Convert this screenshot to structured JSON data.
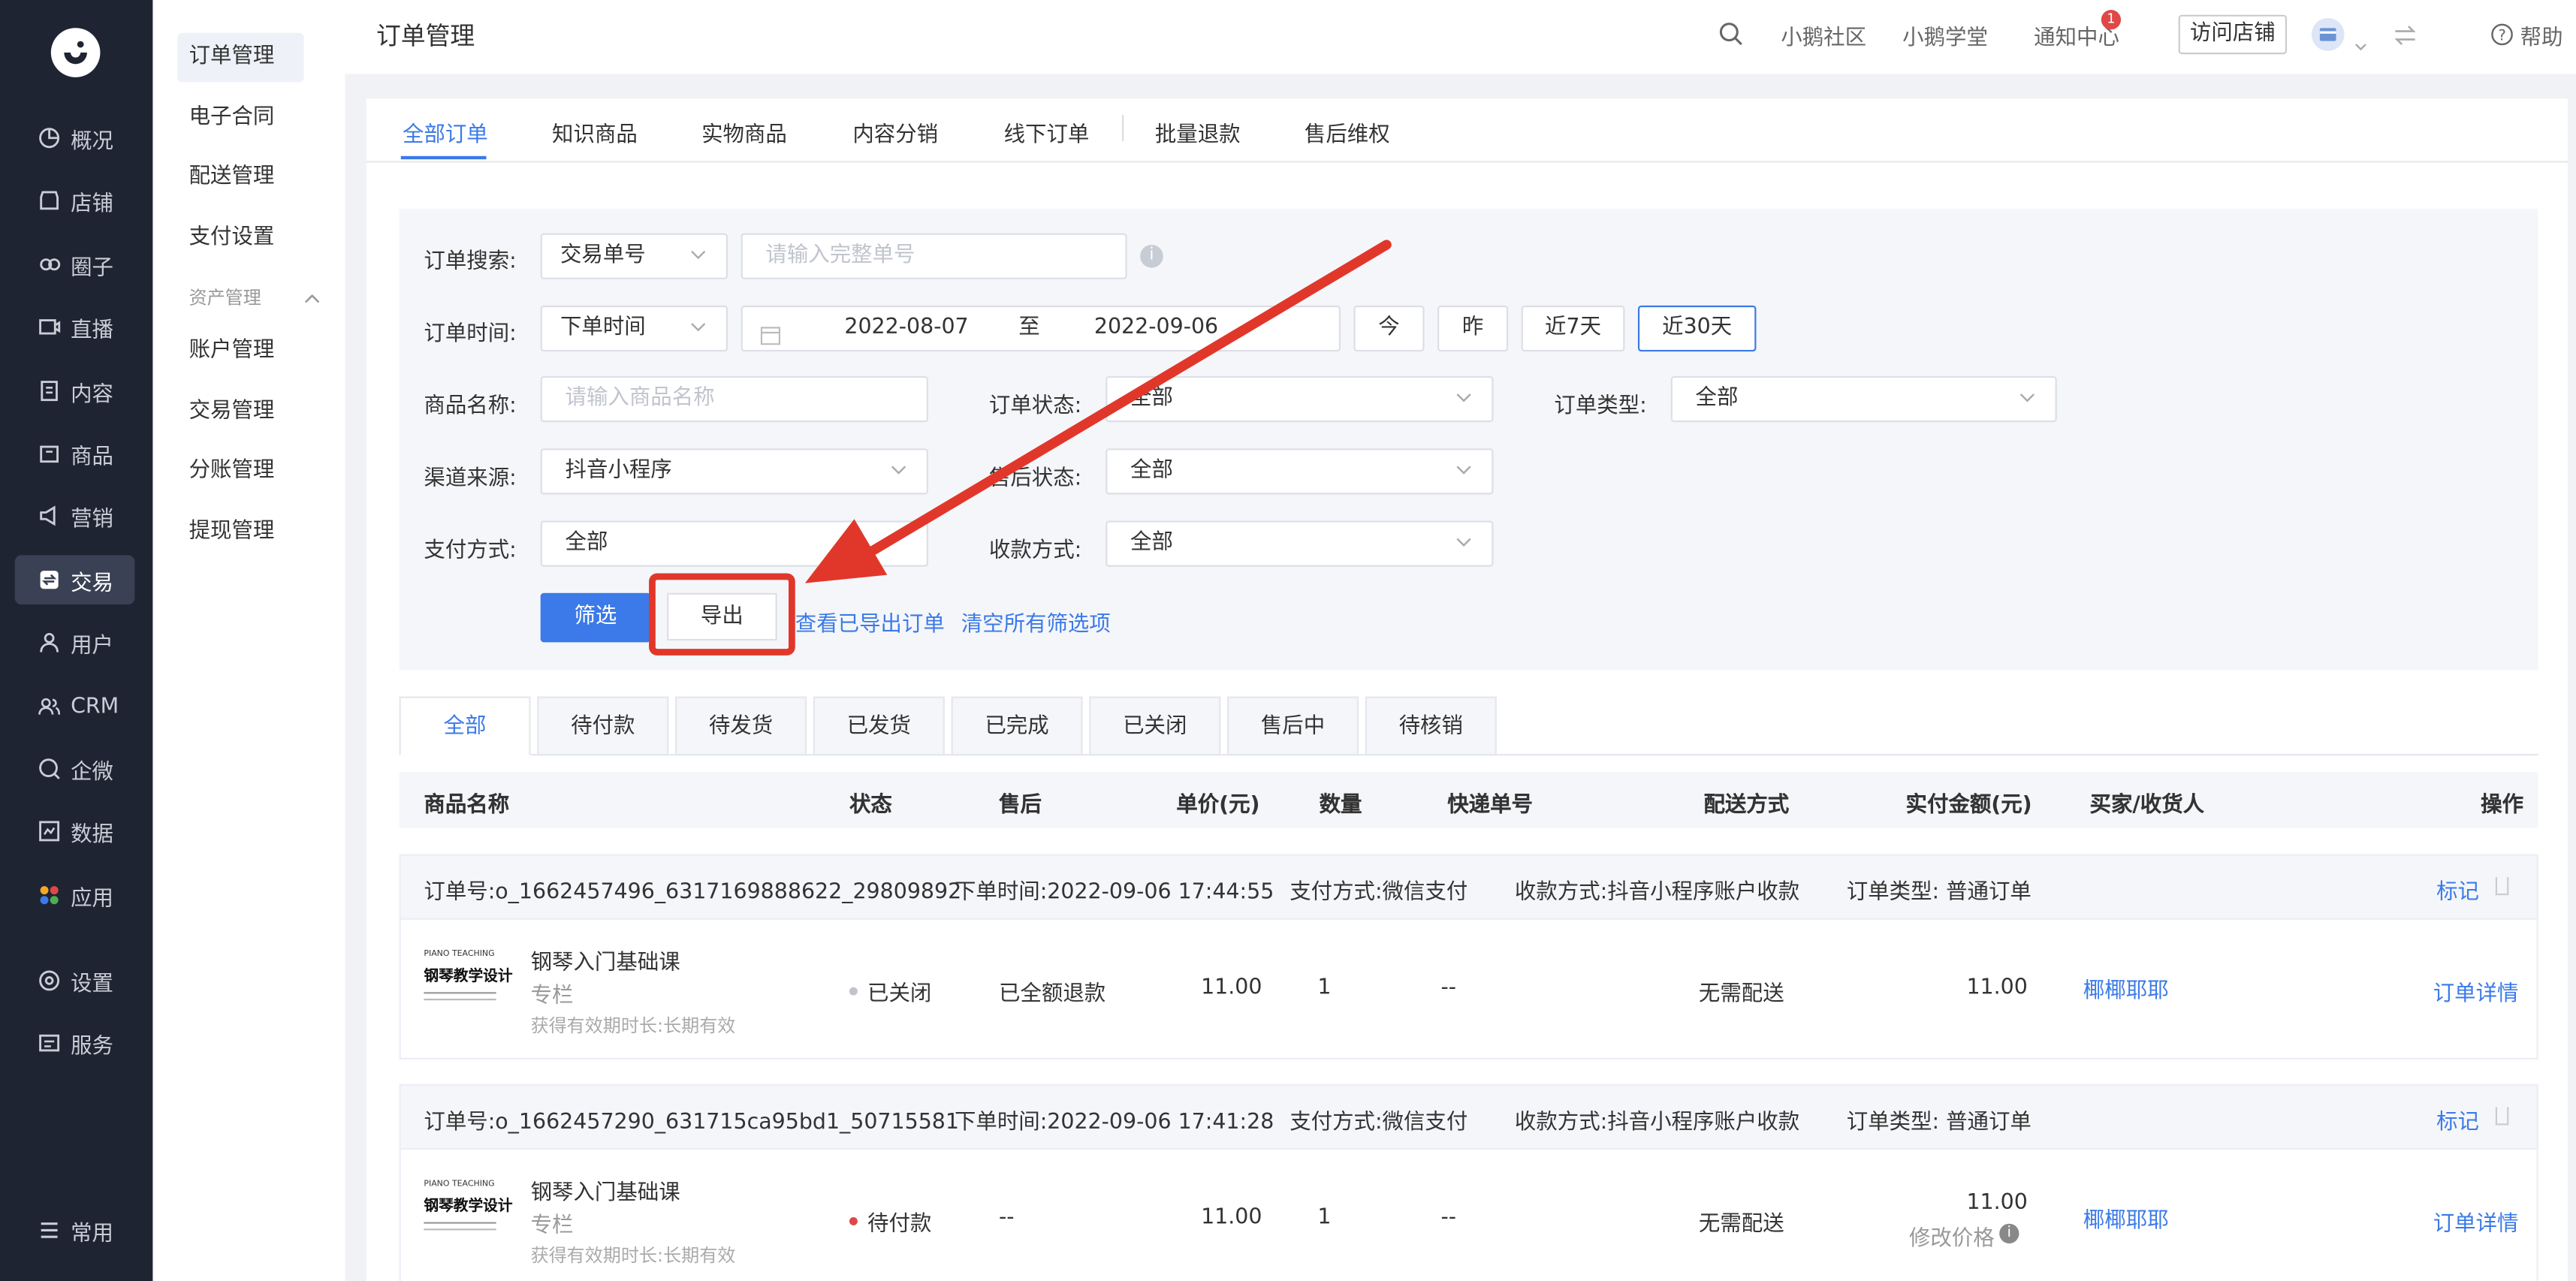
{
  "nav": {
    "items": [
      {
        "label": "概况",
        "icon": "overview-icon"
      },
      {
        "label": "店铺",
        "icon": "store-icon"
      },
      {
        "label": "圈子",
        "icon": "circle-icon"
      },
      {
        "label": "直播",
        "icon": "live-icon"
      },
      {
        "label": "内容",
        "icon": "content-icon"
      },
      {
        "label": "商品",
        "icon": "goods-icon"
      },
      {
        "label": "营销",
        "icon": "marketing-icon"
      },
      {
        "label": "交易",
        "icon": "trade-icon"
      },
      {
        "label": "用户",
        "icon": "user-icon"
      },
      {
        "label": "CRM",
        "icon": "crm-icon"
      },
      {
        "label": "企微",
        "icon": "wecom-icon"
      },
      {
        "label": "数据",
        "icon": "data-icon"
      },
      {
        "label": "应用",
        "icon": "apps-icon"
      },
      {
        "label": "设置",
        "icon": "settings-icon"
      },
      {
        "label": "服务",
        "icon": "service-icon"
      }
    ],
    "common": "常用"
  },
  "subnav": {
    "items": [
      "订单管理",
      "电子合同",
      "配送管理",
      "支付设置"
    ],
    "group": "资产管理",
    "group_items": [
      "账户管理",
      "交易管理",
      "分账管理",
      "提现管理"
    ]
  },
  "topbar": {
    "title": "订单管理",
    "links": [
      "小鹅社区",
      "小鹅学堂",
      "通知中心"
    ],
    "badge": "1",
    "visit": "访问店铺",
    "help": "帮助"
  },
  "tabs": [
    "全部订单",
    "知识商品",
    "实物商品",
    "内容分销",
    "线下订单",
    "批量退款",
    "售后维权"
  ],
  "filter": {
    "search_label": "订单搜索:",
    "search_type": "交易单号",
    "search_placeholder": "请输入完整单号",
    "time_label": "订单时间:",
    "time_type": "下单时间",
    "date_start": "2022-08-07",
    "date_sep": "至",
    "date_end": "2022-09-06",
    "quick": [
      "今",
      "昨",
      "近7天",
      "近30天"
    ],
    "product_label": "商品名称:",
    "product_placeholder": "请输入商品名称",
    "order_status_label": "订单状态:",
    "order_status": "全部",
    "order_type_label": "订单类型:",
    "order_type": "全部",
    "channel_label": "渠道来源:",
    "channel": "抖音小程序",
    "after_label": "售后状态:",
    "after": "全部",
    "pay_label": "支付方式:",
    "pay": "全部",
    "collect_label": "收款方式:",
    "collect": "全部",
    "filter_btn": "筛选",
    "export_btn": "导出",
    "view_exported": "查看已导出订单",
    "clear": "清空所有筛选项"
  },
  "status_tabs": [
    "全部",
    "待付款",
    "待发货",
    "已发货",
    "已完成",
    "已关闭",
    "售后中",
    "待核销"
  ],
  "table": {
    "headers": [
      "商品名称",
      "状态",
      "售后",
      "单价(元)",
      "数量",
      "快递单号",
      "配送方式",
      "实付金额(元)",
      "买家/收货人",
      "操作"
    ]
  },
  "orders": [
    {
      "order_no": "订单号:o_1662457496_6317169888622_29809892",
      "time": "下单时间:2022-09-06 17:44:55",
      "pay": "支付方式:微信支付",
      "collect": "收款方式:抖音小程序账户收款",
      "type": "订单类型: 普通订单",
      "mark": "标记",
      "product": "钢琴入门基础课",
      "category": "专栏",
      "validity": "获得有效期时长:长期有效",
      "thumb_small": "PIANO TEACHING",
      "thumb_big": "钢琴教学设计",
      "status": "已关闭",
      "status_color": "#c0c4cc",
      "after": "已全额退款",
      "price": "11.00",
      "qty": "1",
      "express": "--",
      "delivery": "无需配送",
      "paid": "11.00",
      "modify": "",
      "buyer": "椰椰耶耶",
      "detail": "订单详情"
    },
    {
      "order_no": "订单号:o_1662457290_631715ca95bd1_50715581",
      "time": "下单时间:2022-09-06 17:41:28",
      "pay": "支付方式:微信支付",
      "collect": "收款方式:抖音小程序账户收款",
      "type": "订单类型: 普通订单",
      "mark": "标记",
      "product": "钢琴入门基础课",
      "category": "专栏",
      "validity": "获得有效期时长:长期有效",
      "thumb_small": "PIANO TEACHING",
      "thumb_big": "钢琴教学设计",
      "status": "待付款",
      "status_color": "#e04848",
      "after": "--",
      "price": "11.00",
      "qty": "1",
      "express": "--",
      "delivery": "无需配送",
      "paid": "11.00",
      "modify": "修改价格",
      "buyer": "椰椰耶耶",
      "detail": "订单详情"
    }
  ]
}
